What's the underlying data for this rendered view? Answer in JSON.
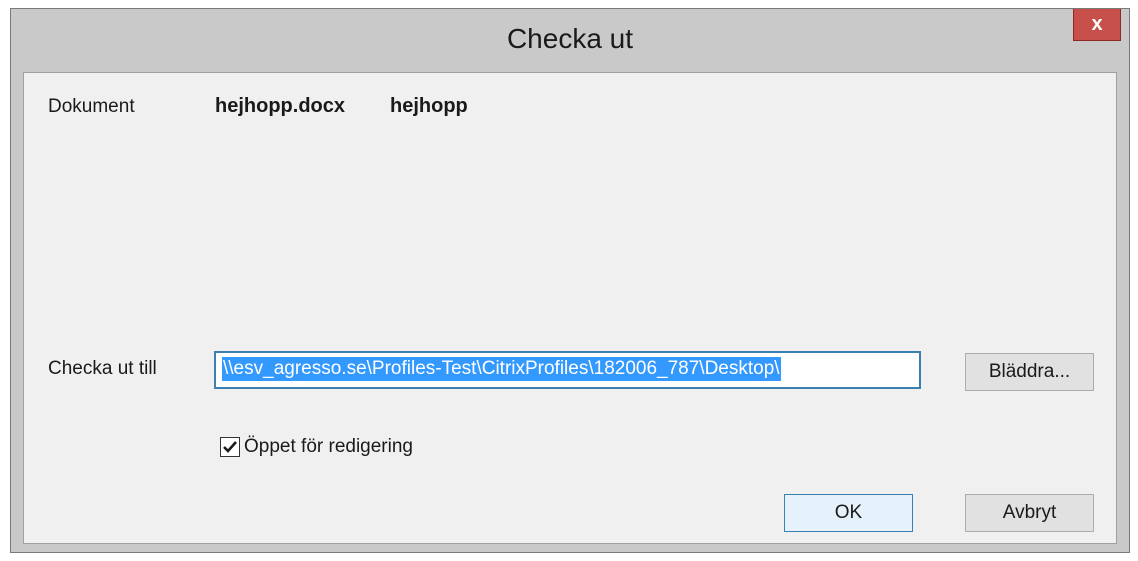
{
  "window": {
    "title": "Checka ut",
    "close_label": "x"
  },
  "document": {
    "label": "Dokument",
    "filename": "hejhopp.docx",
    "name": "hejhopp"
  },
  "checkout": {
    "label": "Checka ut till",
    "path": "\\\\esv_agresso.se\\Profiles-Test\\CitrixProfiles\\182006_787\\Desktop\\",
    "browse_label": "Bläddra..."
  },
  "open_for_edit": {
    "label": "Öppet för redigering",
    "checked": true
  },
  "buttons": {
    "ok_label": "OK",
    "cancel_label": "Avbryt"
  },
  "colors": {
    "close_button": "#c7504b",
    "selection": "#3399ff",
    "focus_border": "#3c7fb1"
  }
}
